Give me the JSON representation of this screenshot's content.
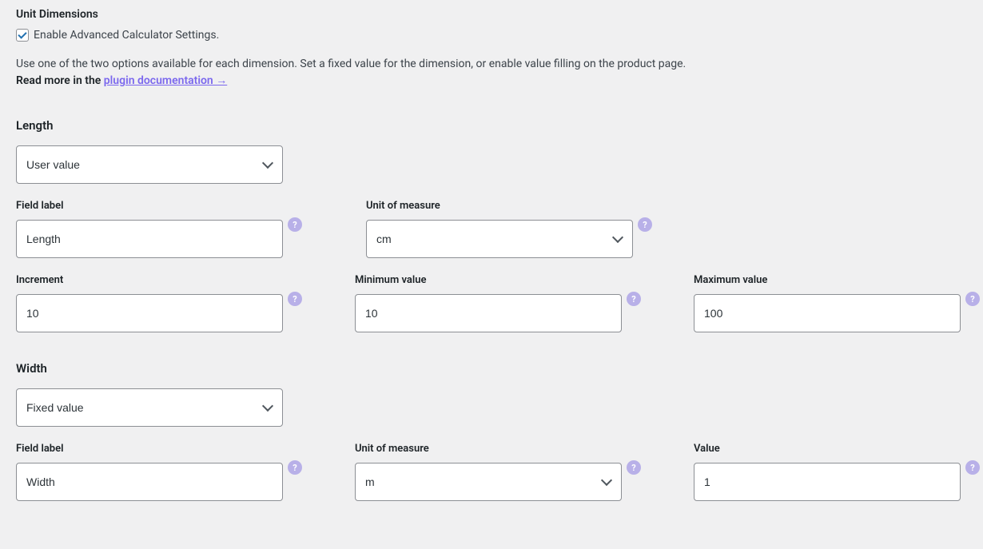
{
  "header": {
    "title": "Unit Dimensions",
    "checkbox_label": "Enable Advanced Calculator Settings.",
    "description_prefix": "Use one of the two options available for each dimension. Set a fixed value for the dimension, or enable value filling on the product page.",
    "description_bold_prefix": "Read more in the ",
    "description_link": "plugin documentation →"
  },
  "length": {
    "heading": "Length",
    "type_value": "User value",
    "field_label_label": "Field label",
    "field_label_value": "Length",
    "unit_label": "Unit of measure",
    "unit_value": "cm",
    "increment_label": "Increment",
    "increment_value": "10",
    "min_label": "Minimum value",
    "min_value": "10",
    "max_label": "Maximum value",
    "max_value": "100"
  },
  "width": {
    "heading": "Width",
    "type_value": "Fixed value",
    "field_label_label": "Field label",
    "field_label_value": "Width",
    "unit_label": "Unit of measure",
    "unit_value": "m",
    "value_label": "Value",
    "value_value": "1"
  },
  "help_glyph": "?"
}
